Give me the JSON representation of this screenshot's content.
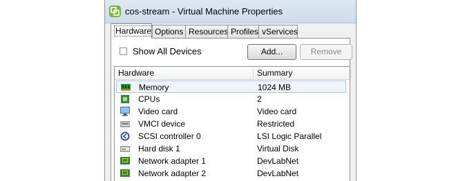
{
  "window": {
    "title": "cos-stream - Virtual Machine Properties"
  },
  "tabs": [
    {
      "label": "Hardware",
      "active": true
    },
    {
      "label": "Options",
      "active": false
    },
    {
      "label": "Resources",
      "active": false
    },
    {
      "label": "Profiles",
      "active": false
    },
    {
      "label": "vServices",
      "active": false
    }
  ],
  "controls": {
    "show_all_devices": {
      "label": "Show All Devices",
      "checked": false
    },
    "add_label": "Add...",
    "remove_label": "Remove"
  },
  "table": {
    "columns": [
      "Hardware",
      "Summary"
    ],
    "rows": [
      {
        "name": "Memory",
        "summary": "1024 MB",
        "icon": "memory-icon",
        "selected": true
      },
      {
        "name": "CPUs",
        "summary": "2",
        "icon": "cpu-icon"
      },
      {
        "name": "Video card",
        "summary": "Video card",
        "icon": "monitor-icon"
      },
      {
        "name": "VMCI device",
        "summary": "Restricted",
        "icon": "vmci-device-icon"
      },
      {
        "name": "SCSI controller 0",
        "summary": "LSI Logic Parallel",
        "icon": "scsi-controller-icon"
      },
      {
        "name": "Hard disk 1",
        "summary": "Virtual Disk",
        "icon": "hard-disk-icon"
      },
      {
        "name": "Network adapter 1",
        "summary": "DevLabNet",
        "icon": "network-adapter-icon"
      },
      {
        "name": "Network adapter 2",
        "summary": "DevLabNet",
        "icon": "network-adapter-icon"
      }
    ]
  },
  "colors": {
    "selection_bg": "#eef4fb",
    "selection_border": "#a8c4e8",
    "vmware_logo": "#78b833"
  }
}
